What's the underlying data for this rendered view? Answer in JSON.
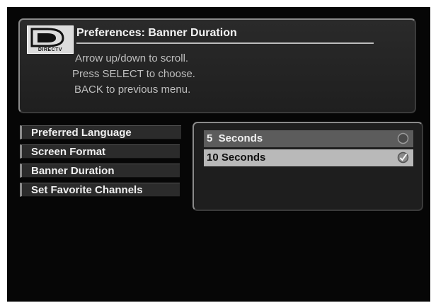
{
  "header": {
    "logo_text": "DIRECTV",
    "title": "Preferences: Banner Duration",
    "instructions": [
      "Arrow up/down to scroll.",
      "Press SELECT to choose.",
      "BACK to previous menu."
    ]
  },
  "menu": {
    "items": [
      {
        "label": "Preferred Language"
      },
      {
        "label": "Screen Format"
      },
      {
        "label": "Banner Duration"
      },
      {
        "label": "Set Favorite Channels"
      }
    ]
  },
  "options": {
    "items": [
      {
        "label": "5  Seconds",
        "selected": false,
        "icon": "radio-empty-icon"
      },
      {
        "label": "10 Seconds",
        "selected": true,
        "icon": "check-circle-icon"
      }
    ]
  },
  "colors": {
    "background": "#060606",
    "panel": "#1f1f1f",
    "highlight": "#b9b9b9",
    "option_bar": "#5c5c5c"
  }
}
